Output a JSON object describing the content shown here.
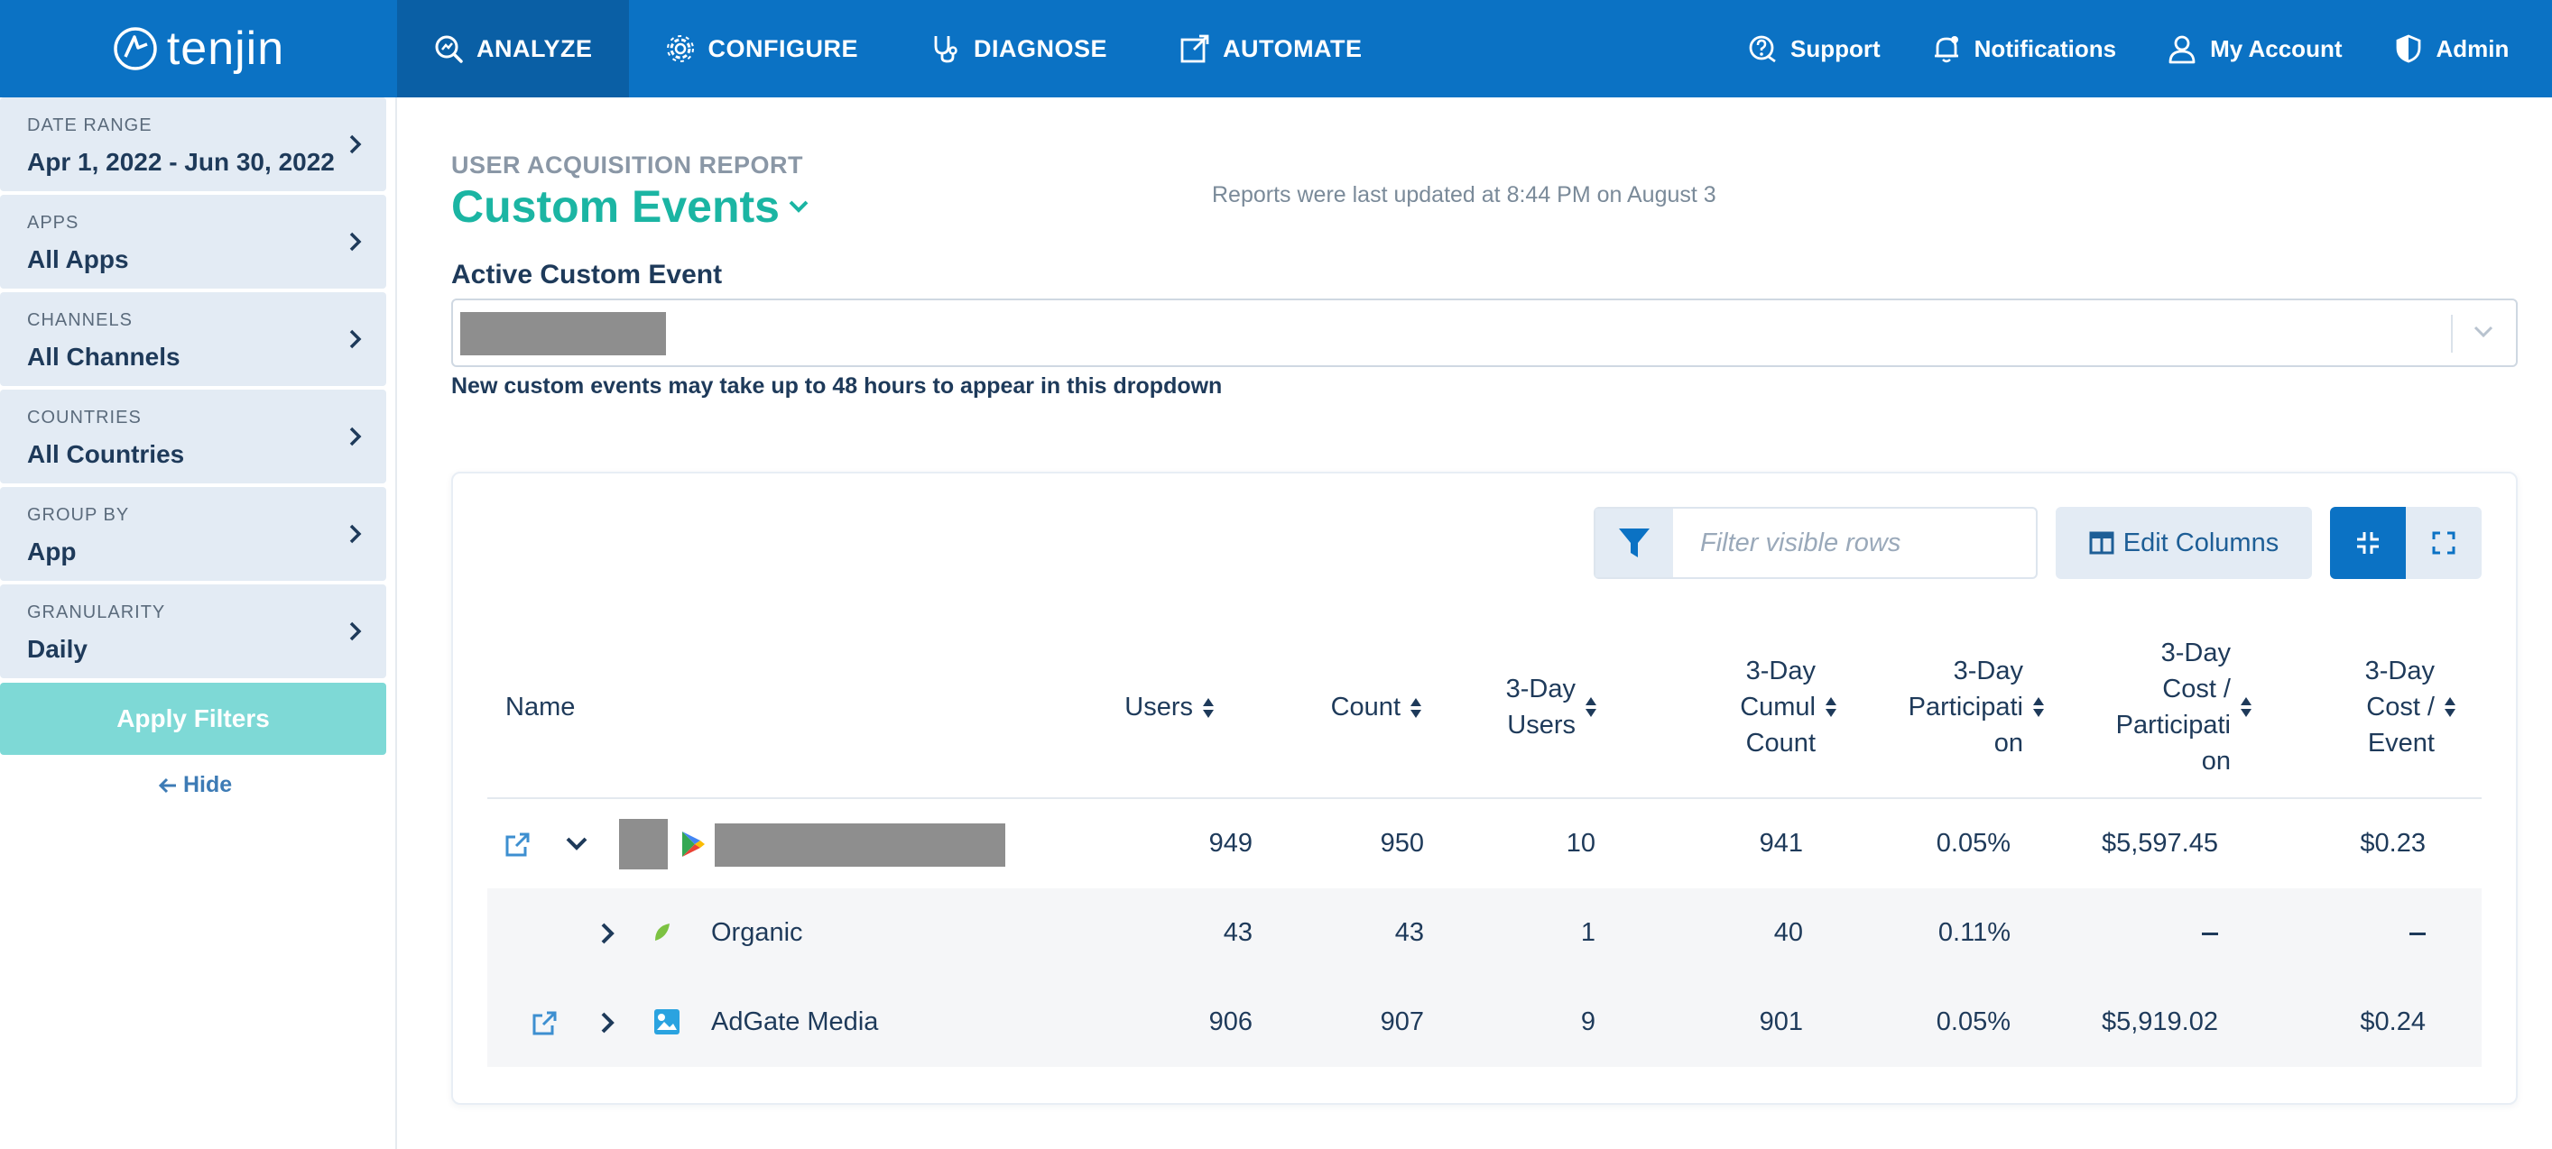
{
  "nav": {
    "logo_text": "tenjin",
    "items": [
      {
        "label": "ANALYZE",
        "icon": "analyze-icon",
        "active": true
      },
      {
        "label": "CONFIGURE",
        "icon": "configure-gear-icon",
        "active": false
      },
      {
        "label": "DIAGNOSE",
        "icon": "stethoscope-icon",
        "active": false
      },
      {
        "label": "AUTOMATE",
        "icon": "automate-icon",
        "active": false
      }
    ],
    "right": [
      {
        "label": "Support",
        "icon": "support-icon"
      },
      {
        "label": "Notifications",
        "icon": "bell-icon"
      },
      {
        "label": "My Account",
        "icon": "user-icon"
      },
      {
        "label": "Admin",
        "icon": "shield-icon"
      }
    ]
  },
  "sidebar": {
    "filters": [
      {
        "label": "DATE RANGE",
        "value": "Apr 1, 2022 - Jun 30, 2022"
      },
      {
        "label": "APPS",
        "value": "All Apps"
      },
      {
        "label": "CHANNELS",
        "value": "All Channels"
      },
      {
        "label": "COUNTRIES",
        "value": "All Countries"
      },
      {
        "label": "GROUP BY",
        "value": "App"
      },
      {
        "label": "GRANULARITY",
        "value": "Daily"
      }
    ],
    "apply_label": "Apply Filters",
    "hide_label": "Hide"
  },
  "report": {
    "subtitle": "USER ACQUISITION REPORT",
    "title": "Custom Events",
    "updated": "Reports were last updated at 8:44 PM on August 3",
    "active_event_label": "Active Custom Event",
    "active_event_value": "",
    "help_text": "New custom events may take up to 48 hours to appear in this dropdown"
  },
  "toolbar": {
    "filter_placeholder": "Filter visible rows",
    "edit_columns_label": "Edit Columns"
  },
  "table": {
    "headers": {
      "name": "Name",
      "users": "Users",
      "count": "Count",
      "three_day_users": [
        "3-Day",
        "Users"
      ],
      "three_day_cumul": [
        "3-Day",
        "Cumul",
        "Count"
      ],
      "three_day_part": [
        "3-Day",
        "Participati",
        "on"
      ],
      "three_day_cost_part": [
        "3-Day",
        "Cost /",
        "Participati",
        "on"
      ],
      "three_day_cost_event": [
        "3-Day",
        "Cost /",
        "Event"
      ]
    },
    "rows": [
      {
        "name": "",
        "users": "949",
        "count": "950",
        "three_day_users": "10",
        "three_day_cumul": "941",
        "three_day_part": "0.05%",
        "three_day_cost_part": "$5,597.45",
        "three_day_cost_event": "$0.23"
      },
      {
        "name": "Organic",
        "users": "43",
        "count": "43",
        "three_day_users": "1",
        "three_day_cumul": "40",
        "three_day_part": "0.11%",
        "three_day_cost_part": "",
        "three_day_cost_event": ""
      },
      {
        "name": "AdGate Media",
        "users": "906",
        "count": "907",
        "three_day_users": "9",
        "three_day_cumul": "901",
        "three_day_part": "0.05%",
        "three_day_cost_part": "$5,919.02",
        "three_day_cost_event": "$0.24"
      }
    ]
  },
  "colors": {
    "nav_bg": "#0b72c4",
    "nav_active": "#0a5fa5",
    "accent_teal": "#1bb5a3",
    "apply_btn": "#7ed9d6",
    "card_bg": "#e3ebf4",
    "text_dark": "#1e3a5a"
  }
}
